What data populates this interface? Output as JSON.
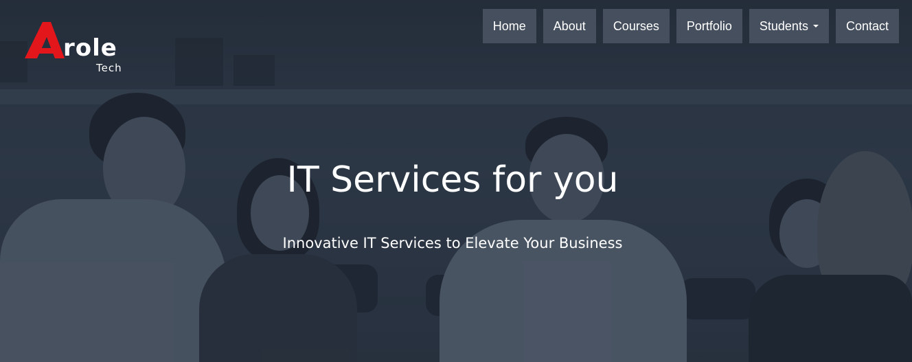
{
  "brand": {
    "logo_main": "role",
    "logo_sub": "Tech",
    "logo_accent_color": "#e3161c"
  },
  "nav": {
    "items": [
      {
        "label": "Home"
      },
      {
        "label": "About"
      },
      {
        "label": "Courses"
      },
      {
        "label": "Portfolio"
      },
      {
        "label": "Students",
        "has_dropdown": true,
        "icon": "caret-down-icon"
      },
      {
        "label": "Contact"
      }
    ]
  },
  "hero": {
    "title": "IT Services for you",
    "subtitle": "Innovative IT Services to Elevate Your Business"
  }
}
